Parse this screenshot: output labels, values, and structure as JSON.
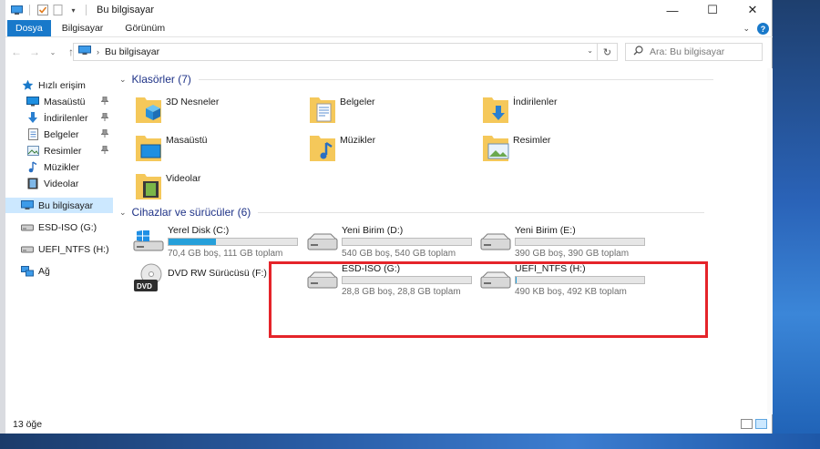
{
  "window": {
    "title": "Bu bilgisayar"
  },
  "ribbon": {
    "tabs": [
      "Dosya",
      "Bilgisayar",
      "Görünüm"
    ]
  },
  "address": {
    "path": "Bu bilgisayar"
  },
  "search": {
    "placeholder": "Ara: Bu bilgisayar"
  },
  "nav": {
    "quick_access": "Hızlı erişim",
    "quick_items": [
      "Masaüstü",
      "İndirilenler",
      "Belgeler",
      "Resimler",
      "Müzikler",
      "Videolar"
    ],
    "this_pc": "Bu bilgisayar",
    "drives": [
      "ESD-ISO (G:)",
      "UEFI_NTFS (H:)"
    ],
    "network": "Ağ"
  },
  "folders_group": {
    "title": "Klasörler (7)"
  },
  "folders": [
    "3D Nesneler",
    "Belgeler",
    "İndirilenler",
    "Masaüstü",
    "Müzikler",
    "Resimler",
    "Videolar"
  ],
  "drives_group": {
    "title": "Cihazlar ve sürücüler (6)"
  },
  "drives": [
    {
      "name": "Yerel Disk (C:)",
      "space": "70,4 GB boş, 111 GB toplam",
      "used_fraction": 0.37
    },
    {
      "name": "Yeni Birim (D:)",
      "space": "540 GB boş, 540 GB toplam",
      "used_fraction": 0.0
    },
    {
      "name": "Yeni Birim (E:)",
      "space": "390 GB boş, 390 GB toplam",
      "used_fraction": 0.0
    },
    {
      "name": "DVD RW Sürücüsü (F:)"
    },
    {
      "name": "ESD-ISO (G:)",
      "space": "28,8 GB boş, 28,8 GB toplam",
      "used_fraction": 0.0
    },
    {
      "name": "UEFI_NTFS (H:)",
      "space": "490 KB boş, 492 KB toplam",
      "used_fraction": 0.004
    }
  ],
  "status": {
    "count": "13 öğe"
  },
  "colors": {
    "accent": "#1979ca",
    "bar_fill": "#26a0da",
    "highlight": "#e5242a",
    "group_title": "#1e3287"
  }
}
